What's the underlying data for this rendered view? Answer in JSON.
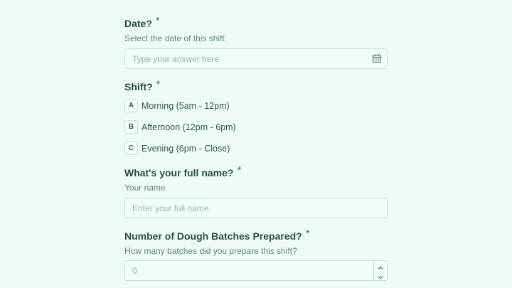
{
  "questions": {
    "date": {
      "title": "Date?",
      "required_mark": "*",
      "description": "Select the date of this shift",
      "placeholder": "Type your answer here",
      "icon": "calendar-icon"
    },
    "shift": {
      "title": "Shift?",
      "required_mark": "*",
      "options": [
        {
          "key": "A",
          "label": "Morning (5am - 12pm)"
        },
        {
          "key": "B",
          "label": "Afternoon (12pm - 6pm)"
        },
        {
          "key": "C",
          "label": "Evening (6pm - Close)"
        }
      ]
    },
    "name": {
      "title": "What's your full name?",
      "required_mark": "*",
      "description": "Your name",
      "placeholder": "Enter your full name"
    },
    "batches": {
      "title": "Number of Dough Batches Prepared?",
      "required_mark": "*",
      "description": "How many batches did you prepare this shift?",
      "placeholder": "0",
      "icons": [
        "chevron-up-icon",
        "chevron-down-icon"
      ]
    }
  },
  "colors": {
    "background": "#effcf6",
    "border": "#bfe3d4",
    "text": "#2a5a4c",
    "placeholder": "#9bb5ab"
  }
}
